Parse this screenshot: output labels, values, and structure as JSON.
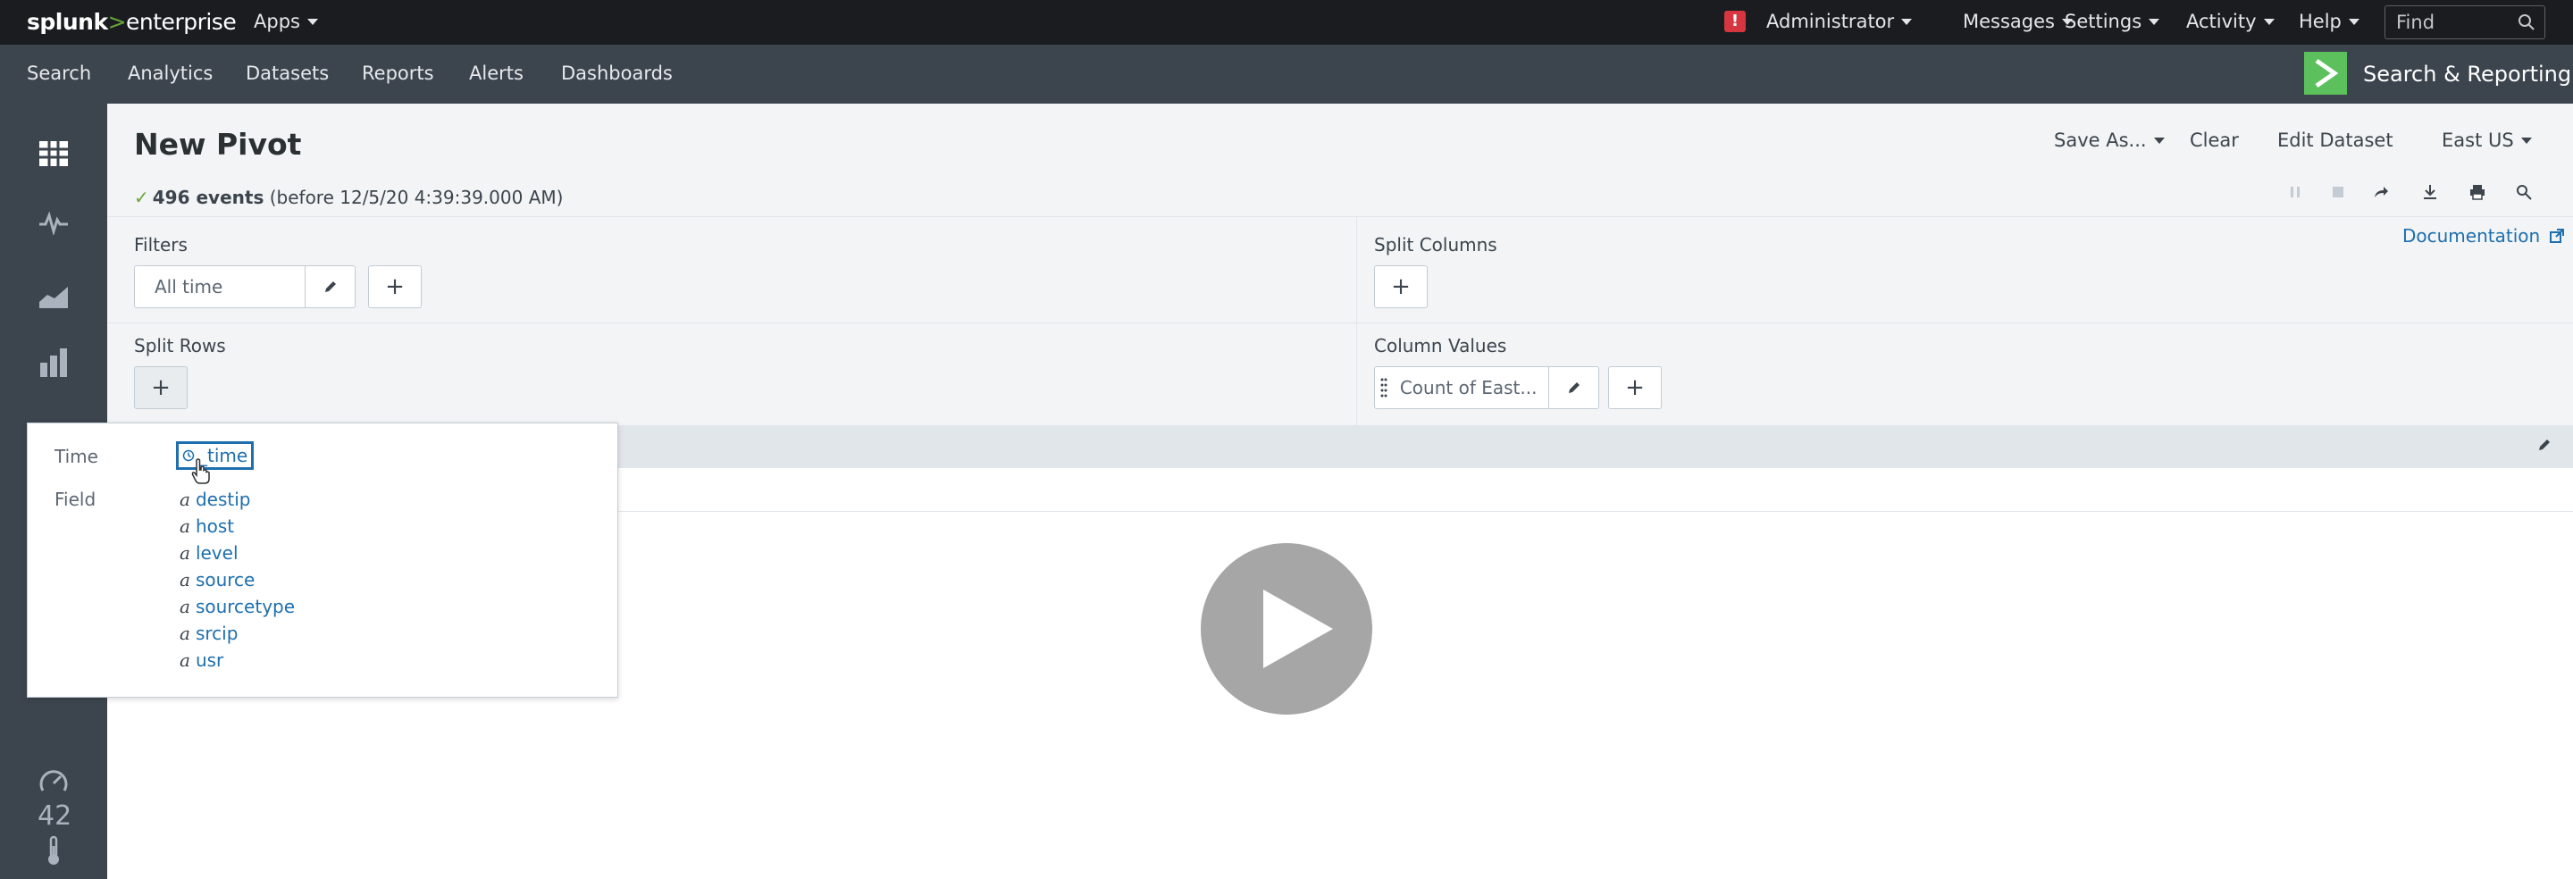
{
  "topbar": {
    "logo_brand": "splunk",
    "logo_gt": ">",
    "logo_product": "enterprise",
    "apps": "Apps",
    "user": "Administrator",
    "messages": "Messages",
    "settings": "Settings",
    "activity": "Activity",
    "help": "Help",
    "find_placeholder": "Find",
    "alert_glyph": "!"
  },
  "appnav": {
    "items": [
      "Search",
      "Analytics",
      "Datasets",
      "Reports",
      "Alerts",
      "Dashboards"
    ],
    "app_name": "Search & Reporting"
  },
  "sidebar": {
    "number_badge": "42",
    "icons": [
      "table-icon",
      "pulse-icon",
      "area-chart-icon",
      "bar-chart-icon",
      "single-value-icon",
      "gauge-icon",
      "thermometer-icon"
    ]
  },
  "header": {
    "title": "New Pivot",
    "save_as": "Save As...",
    "clear": "Clear",
    "edit_dataset": "Edit Dataset",
    "dataset": "East US",
    "check": "✓",
    "events_count": "496 events",
    "events_detail": "(before 12/5/20 4:39:39.000 AM)"
  },
  "config": {
    "filters_label": "Filters",
    "filter_value": "All time",
    "split_columns_label": "Split Columns",
    "split_rows_label": "Split Rows",
    "column_values_label": "Column Values",
    "column_value": "Count of East...",
    "documentation": "Documentation",
    "plus": "+"
  },
  "popup": {
    "time_label": "Time",
    "time_field": "_time",
    "field_label": "Field",
    "type_glyph": "a",
    "fields": [
      "destip",
      "host",
      "level",
      "source",
      "sourcetype",
      "srcip",
      "usr"
    ]
  },
  "colors": {
    "topbar_bg": "#1a1c20",
    "appbar_bg": "#3c444d",
    "accent_green": "#65a637",
    "app_logo_green": "#5cc05c",
    "link_blue": "#1e6fae",
    "alert_red": "#d6363f",
    "panel_bg": "#f2f4f5"
  }
}
